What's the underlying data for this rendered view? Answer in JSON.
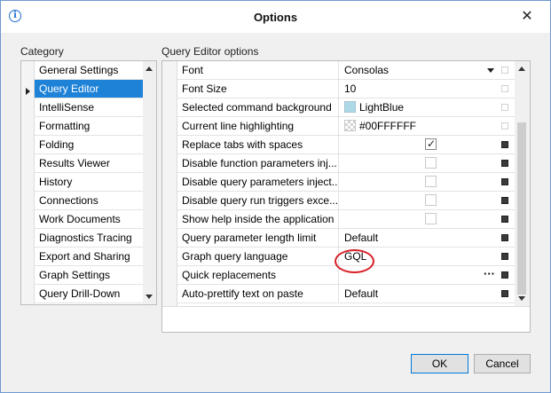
{
  "window": {
    "title": "Options",
    "info_icon_glyph": "i",
    "close_glyph": "✕"
  },
  "category": {
    "label": "Category",
    "items": [
      "General Settings",
      "Query Editor",
      "IntelliSense",
      "Formatting",
      "Folding",
      "Results Viewer",
      "History",
      "Connections",
      "Work Documents",
      "Diagnostics Tracing",
      "Export and Sharing",
      "Graph Settings",
      "Query Drill-Down"
    ],
    "selected_index": 1
  },
  "options": {
    "label": "Query Editor options",
    "rows": [
      {
        "name": "Font",
        "value": "Consolas",
        "kind": "dropdown",
        "flag": "dim"
      },
      {
        "name": "Font Size",
        "value": "10",
        "kind": "text",
        "flag": "dim"
      },
      {
        "name": "Selected command background",
        "value": "LightBlue",
        "kind": "color",
        "swatch": "#add8e6",
        "flag": "dim"
      },
      {
        "name": "Current line highlighting",
        "value": "#00FFFFFF",
        "kind": "color-transparent",
        "flag": "dim"
      },
      {
        "name": "Replace tabs with spaces",
        "value": "",
        "kind": "checkbox",
        "checked": true,
        "flag": "on"
      },
      {
        "name": "Disable function parameters inj...",
        "value": "",
        "kind": "checkbox",
        "checked": false,
        "flag": "on"
      },
      {
        "name": "Disable query parameters inject...",
        "value": "",
        "kind": "checkbox",
        "checked": false,
        "flag": "on"
      },
      {
        "name": "Disable query run triggers exce...",
        "value": "",
        "kind": "checkbox",
        "checked": false,
        "flag": "on"
      },
      {
        "name": "Show help inside the application",
        "value": "",
        "kind": "checkbox",
        "checked": false,
        "flag": "on"
      },
      {
        "name": "Query parameter length limit",
        "value": "Default",
        "kind": "text",
        "flag": "on"
      },
      {
        "name": "Graph query language",
        "value": "GQL",
        "kind": "text",
        "flag": "on",
        "highlighted": true
      },
      {
        "name": "Quick replacements",
        "value": "",
        "kind": "ellipsis",
        "ellipsis": "···",
        "flag": "on"
      },
      {
        "name": "Auto-prettify text on paste",
        "value": "Default",
        "kind": "text",
        "flag": "on"
      }
    ]
  },
  "buttons": {
    "ok": "OK",
    "cancel": "Cancel"
  },
  "colors": {
    "selection": "#1e82d7",
    "highlight_ring": "#d81f27",
    "window_border": "#6e9ad2"
  }
}
